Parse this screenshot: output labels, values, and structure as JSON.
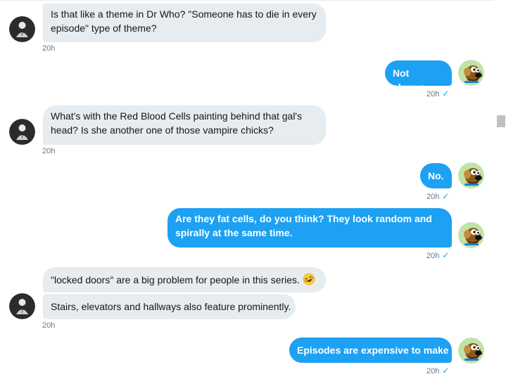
{
  "messages": [
    {
      "side": "received",
      "text": "Is that like a theme in Dr Who? \"Someone has to die in every episode\" type of theme?",
      "line1": "Is that like a theme in Dr Who? \"Someone has to die in every",
      "line2": "episode\" type of theme?",
      "time": "20h"
    },
    {
      "side": "sent",
      "text": "Not always.",
      "time": "20h"
    },
    {
      "side": "received",
      "text": "What's with the Red Blood Cells painting behind that gal's head? Is she another one of those vampire chicks?",
      "line1": "What's with the Red Blood Cells painting behind that gal's",
      "line2": "head? Is she another one of those vampire chicks?",
      "time": "20h"
    },
    {
      "side": "sent",
      "text": "No.",
      "time": "20h"
    },
    {
      "side": "sent",
      "text": "Are they fat cells, do you think? They look random and spirally at the same time.",
      "line1": "Are they fat cells, do you think? They look random and",
      "line2": "spirally at the same time.",
      "time": "20h"
    },
    {
      "side": "received",
      "text": "\"locked doors\" are a big problem for people in this series.",
      "emoji": "rolling-on-floor-laughing-emoji"
    },
    {
      "side": "received",
      "text": "Stairs, elevators and hallways also feature prominently.",
      "time": "20h"
    },
    {
      "side": "sent",
      "text": "Episodes are expensive to make ;)",
      "time": "20h"
    }
  ],
  "status": {
    "check": "✓"
  },
  "colors": {
    "sent_bubble": "#1da1f2",
    "received_bubble": "#e6ecf0",
    "timestamp": "#657786"
  }
}
